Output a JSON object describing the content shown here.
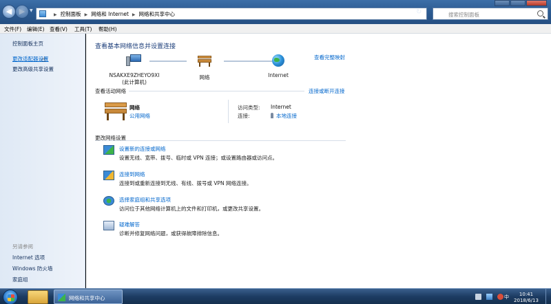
{
  "address_bar": {
    "crumbs": [
      "控制面板",
      "网络和 Internet",
      "网络和共享中心"
    ],
    "search_placeholder": "搜索控制面板"
  },
  "menu": [
    "文件(F)",
    "编辑(E)",
    "查看(V)",
    "工具(T)",
    "帮助(H)"
  ],
  "sidebar": {
    "links": [
      "控制面板主页",
      "更改适配器设置",
      "更改高级共享设置"
    ],
    "see_also_title": "另请参阅",
    "see_also": [
      "Internet 选项",
      "Windows 防火墙",
      "家庭组"
    ]
  },
  "main": {
    "title": "查看基本网络信息并设置连接",
    "full_map_link": "查看完整映射",
    "map": {
      "computer_name": "NSAKXE9ZHEYO9XI",
      "computer_sub": "(此计算机)",
      "network": "网络",
      "internet": "Internet"
    },
    "active_networks_label": "查看活动网络",
    "connect_disconnect_link": "连接或断开连接",
    "active_network": {
      "name": "网络",
      "type": "公用网络",
      "access_type_key": "访问类型:",
      "access_type_value": "Internet",
      "connection_key": "连接:",
      "connection_value": "本地连接"
    },
    "change_settings_label": "更改网络设置",
    "tasks": [
      {
        "link": "设置新的连接或网络",
        "desc": "设置无线、宽带、拨号、临时或 VPN 连接；或设置路由器或访问点。"
      },
      {
        "link": "连接到网络",
        "desc": "连接到或重新连接到无线、有线、拨号或 VPN 网络连接。"
      },
      {
        "link": "选择家庭组和共享选项",
        "desc": "访问位于其他网络计算机上的文件和打印机，或更改共享设置。"
      },
      {
        "link": "疑难解答",
        "desc": "诊断并修复网络问题，或获得故障排除信息。"
      }
    ]
  },
  "taskbar": {
    "window_label": "网络和共享中心",
    "time": "10:41",
    "date": "2018/6/13"
  }
}
